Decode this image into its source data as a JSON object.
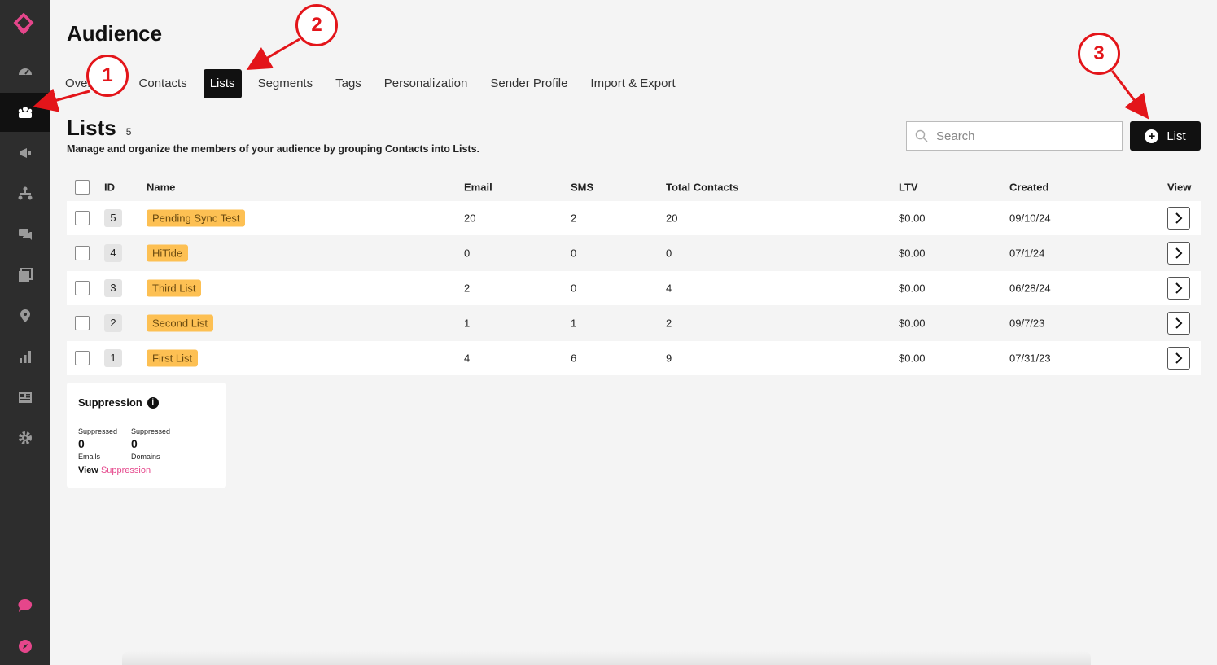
{
  "header": {
    "title": "Audience",
    "tabs": [
      {
        "label": "Overview"
      },
      {
        "label": "Contacts"
      },
      {
        "label": "Lists"
      },
      {
        "label": "Segments"
      },
      {
        "label": "Tags"
      },
      {
        "label": "Personalization"
      },
      {
        "label": "Sender Profile"
      },
      {
        "label": "Import & Export"
      }
    ],
    "active_tab": "Lists"
  },
  "sidebar": {
    "icons": [
      "logo-icon",
      "dashboard-icon",
      "audience-icon",
      "campaign-icon",
      "flows-icon",
      "messages-icon",
      "media-icon",
      "location-icon",
      "analytics-icon",
      "forms-icon",
      "settings-icon",
      "chat-icon",
      "compass-icon"
    ],
    "active": "audience-icon",
    "accent_color": "#e5468b"
  },
  "lists": {
    "title": "Lists",
    "count": "5",
    "description": "Manage and organize the members of your audience by grouping Contacts into Lists.",
    "search_placeholder": "Search",
    "add_button_label": "List"
  },
  "table": {
    "columns": {
      "id": "ID",
      "name": "Name",
      "email": "Email",
      "sms": "SMS",
      "total": "Total Contacts",
      "ltv": "LTV",
      "created": "Created",
      "view": "View"
    },
    "rows": [
      {
        "id": "5",
        "name": "Pending Sync Test",
        "email": "20",
        "sms": "2",
        "total": "20",
        "ltv": "$0.00",
        "created": "09/10/24"
      },
      {
        "id": "4",
        "name": "HiTide",
        "email": "0",
        "sms": "0",
        "total": "0",
        "ltv": "$0.00",
        "created": "07/1/24"
      },
      {
        "id": "3",
        "name": "Third List",
        "email": "2",
        "sms": "0",
        "total": "4",
        "ltv": "$0.00",
        "created": "06/28/24"
      },
      {
        "id": "2",
        "name": "Second List",
        "email": "1",
        "sms": "1",
        "total": "2",
        "ltv": "$0.00",
        "created": "09/7/23"
      },
      {
        "id": "1",
        "name": "First List",
        "email": "4",
        "sms": "6",
        "total": "9",
        "ltv": "$0.00",
        "created": "07/31/23"
      }
    ],
    "tag_color": "#fdc053"
  },
  "suppression": {
    "title": "Suppression",
    "emails": {
      "top": "Suppressed",
      "value": "0",
      "bottom": "Emails"
    },
    "domains": {
      "top": "Suppressed",
      "value": "0",
      "bottom": "Domains"
    },
    "view_label": "View",
    "view_link": "Suppression"
  },
  "annotations": {
    "color": "#e3151a",
    "badges": [
      "1",
      "2",
      "3"
    ]
  }
}
